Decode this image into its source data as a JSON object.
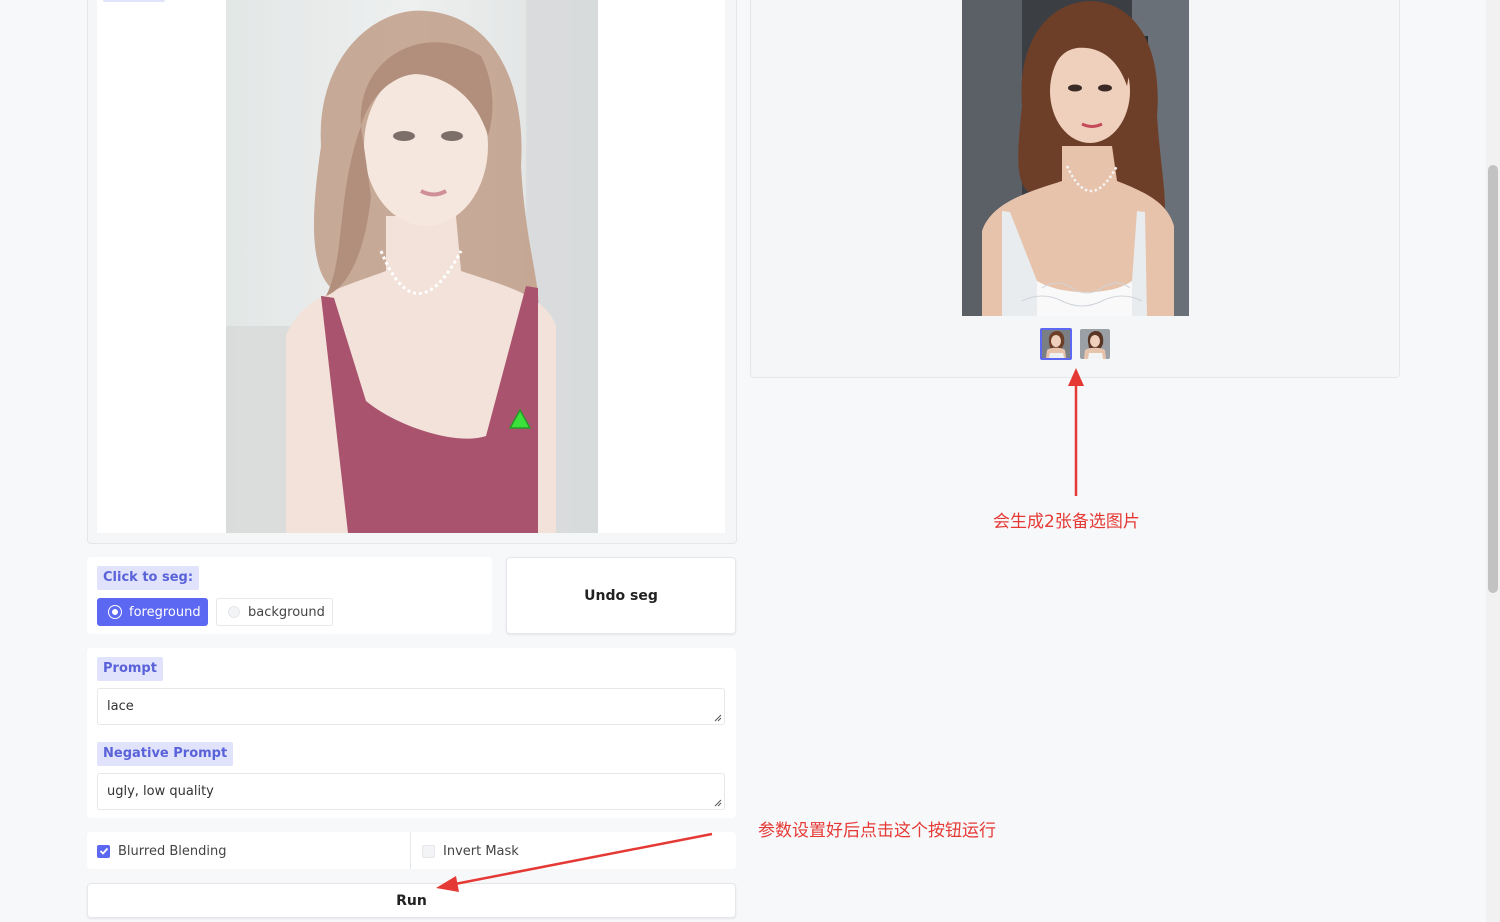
{
  "editor": {
    "canvas_image": "input-portrait-red-dress"
  },
  "segmentation": {
    "label": "Click to seg:",
    "options": [
      "foreground",
      "background"
    ],
    "selected": "foreground",
    "undo_label": "Undo seg"
  },
  "prompts": {
    "prompt_label": "Prompt",
    "prompt_value": "lace",
    "negative_label": "Negative Prompt",
    "negative_value": "ugly, low quality"
  },
  "options": {
    "blurred_label": "Blurred Blending",
    "blurred_checked": true,
    "invert_label": "Invert Mask",
    "invert_checked": false
  },
  "run_label": "Run",
  "gallery": {
    "main_image": "result-portrait-white-lace",
    "thumbnails": [
      "thumbnail-1",
      "thumbnail-2"
    ],
    "selected_thumbnail": 0
  },
  "annotations": {
    "gallery_note": "会生成2张备选图片",
    "run_note": "参数设置好后点击这个按钮运行"
  },
  "colors": {
    "accent": "#5c67f2",
    "label_bg": "#e0e3fb",
    "label_text": "#5a62d9",
    "annotation": "#e53935",
    "seg_marker": "#22dd22"
  }
}
